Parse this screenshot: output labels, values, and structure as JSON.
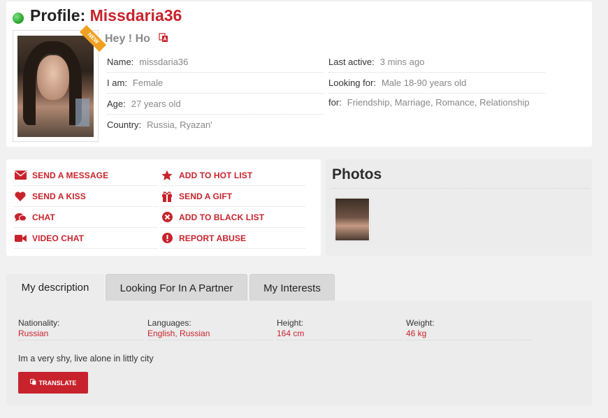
{
  "profile": {
    "title_prefix": "Profile: ",
    "username": "Missdaria36",
    "greeting": "Hey ! Ho",
    "badge": "NEW",
    "fields": {
      "name": {
        "label": "Name:",
        "value": "missdaria36"
      },
      "gender": {
        "label": "I am:",
        "value": "Female"
      },
      "age": {
        "label": "Age:",
        "value": "27 years old"
      },
      "country": {
        "label": "Country:",
        "value": "Russia, Ryazan'"
      },
      "last_active": {
        "label": "Last active:",
        "value": "3 mins ago"
      },
      "looking_for": {
        "label": "Looking for:",
        "value": "Male 18-90 years old"
      },
      "for": {
        "label": "for:",
        "value": "Friendship, Marriage, Romance, Relationship"
      }
    }
  },
  "actions": {
    "send_message": "SEND A MESSAGE",
    "send_kiss": "SEND A KISS",
    "chat": "CHAT",
    "video_chat": "VIDEO CHAT",
    "hot_list": "ADD TO HOT LIST",
    "send_gift": "SEND A GIFT",
    "black_list": "ADD TO BLACK LIST",
    "report_abuse": "REPORT ABUSE"
  },
  "photos": {
    "title": "Photos"
  },
  "tabs": [
    {
      "label": "My description",
      "active": true
    },
    {
      "label": "Looking For In A Partner",
      "active": false
    },
    {
      "label": "My Interests",
      "active": false
    }
  ],
  "description": {
    "nationality": {
      "label": "Nationality:",
      "value": "Russian"
    },
    "languages": {
      "label": "Languages:",
      "value": "English, Russian"
    },
    "height": {
      "label": "Height:",
      "value": "164 cm"
    },
    "weight": {
      "label": "Weight:",
      "value": "46 kg"
    },
    "about": "Im a very shy, live alone in littly city",
    "translate_button": "TRANSLATE"
  },
  "colors": {
    "accent": "#c8232c",
    "online": "#23a023",
    "ribbon": "#f0a020"
  }
}
